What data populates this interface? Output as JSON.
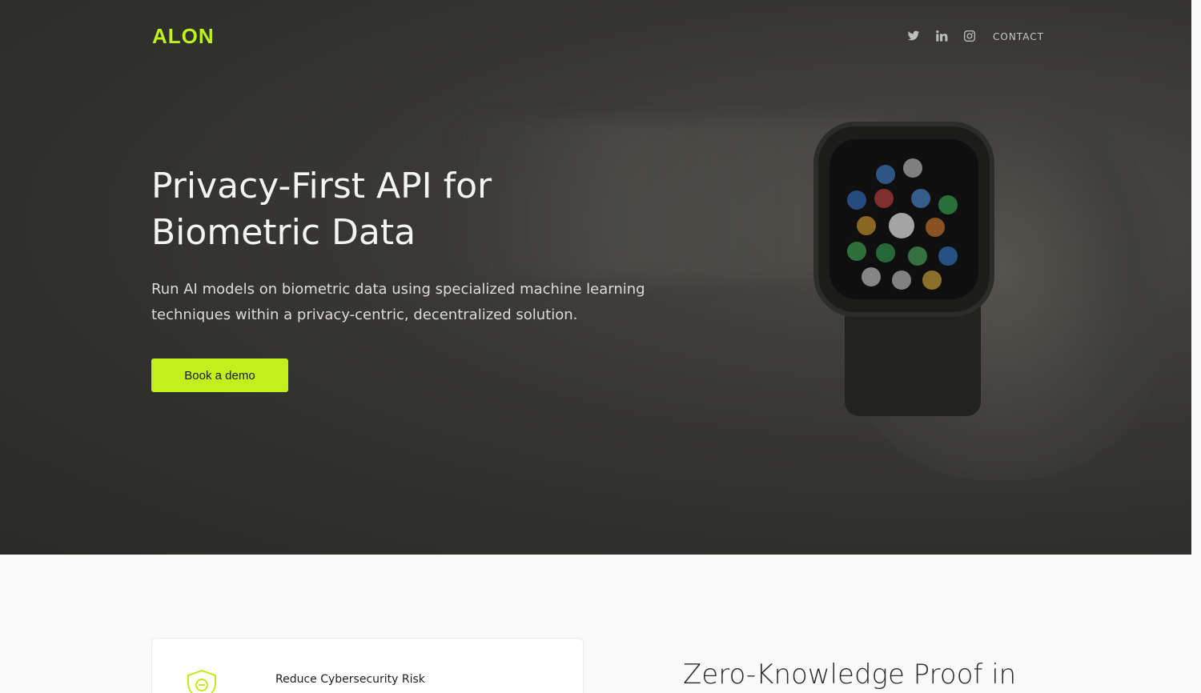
{
  "brand": {
    "logo_text": "ALON",
    "accent": "#bef31f"
  },
  "nav": {
    "social": [
      "twitter-icon",
      "linkedin-icon",
      "instagram-icon"
    ],
    "contact_label": "CONTACT"
  },
  "hero": {
    "title_line1": "Privacy-First API for",
    "title_line2": "Biometric Data",
    "subtitle": "Run AI models on biometric data using specialized machine learning techniques within a privacy-centric, decentralized solution.",
    "cta_label": "Book a demo"
  },
  "feature_card": {
    "title": "Reduce Cybersecurity Risk"
  },
  "section": {
    "heading": "Zero-Knowledge Proof in"
  }
}
